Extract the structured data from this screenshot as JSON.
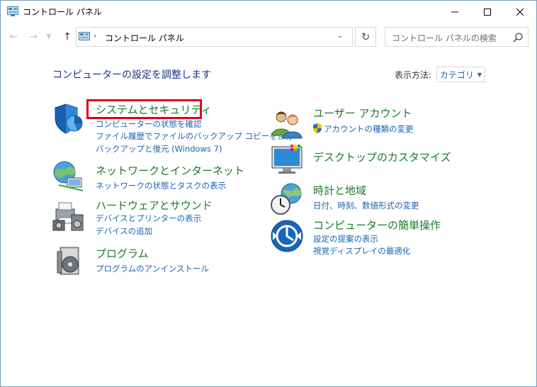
{
  "window": {
    "title": "コントロール パネル",
    "title_icon": "control-panel-icon"
  },
  "nav": {
    "address_text": "コントロール パネル",
    "search_placeholder": "コントロール パネルの検索"
  },
  "main": {
    "heading": "コンピューターの設定を調整します",
    "view_label": "表示方法:",
    "view_value": "カテゴリ"
  },
  "categories": [
    {
      "title": "システムとセキュリティ",
      "icon": "security-shield-icon",
      "links": [
        "コンピューターの状態を確認",
        "ファイル履歴でファイルのバックアップ コピーを保存",
        "バックアップと復元 (Windows 7)"
      ]
    },
    {
      "title": "ネットワークとインターネット",
      "icon": "network-globe-icon",
      "links": [
        "ネットワークの状態とタスクの表示"
      ]
    },
    {
      "title": "ハードウェアとサウンド",
      "icon": "printer-speaker-icon",
      "links": [
        "デバイスとプリンターの表示",
        "デバイスの追加"
      ]
    },
    {
      "title": "プログラム",
      "icon": "programs-disc-icon",
      "links": [
        "プログラムのアンインストール"
      ]
    },
    {
      "title": "ユーザー アカウント",
      "icon": "users-icon",
      "links": [
        "アカウントの種類の変更"
      ]
    },
    {
      "title": "デスクトップのカスタマイズ",
      "icon": "monitor-icon",
      "links": []
    },
    {
      "title": "時計と地域",
      "icon": "clock-globe-icon",
      "links": [
        "日付、時刻、数値形式の変更"
      ]
    },
    {
      "title": "コンピューターの簡単操作",
      "icon": "ease-of-access-icon",
      "links": [
        "設定の提案の表示",
        "視覚ディスプレイの最適化"
      ]
    }
  ],
  "colors": {
    "category_title": "#177a2b",
    "link": "#1a64b4",
    "heading": "#1e3287",
    "highlight": "#e3001b"
  }
}
